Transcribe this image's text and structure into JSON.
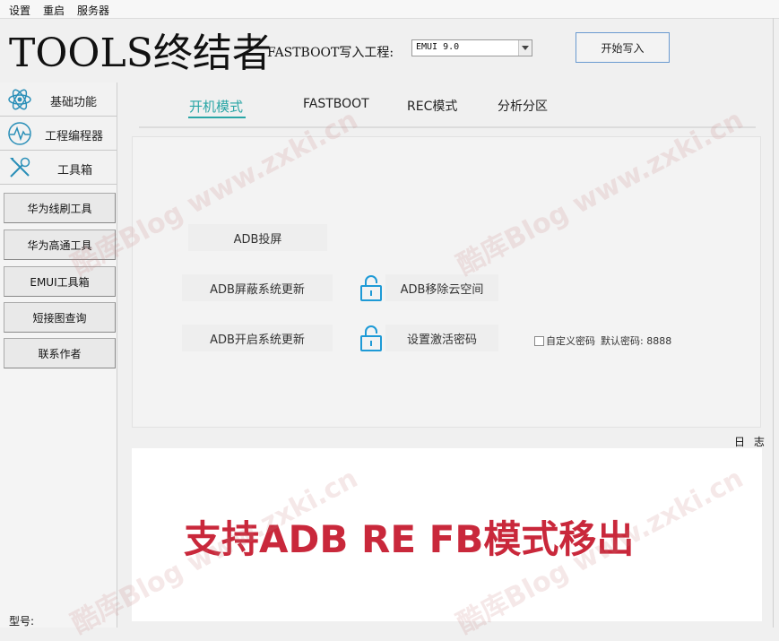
{
  "menu": {
    "items": [
      "设置",
      "重启",
      "服务器"
    ]
  },
  "header": {
    "app_title": "TOOLS终结者",
    "fastboot_label": "FASTBOOT写入工程:",
    "project_value": "EMUI 9.0",
    "start_button": "开始写入"
  },
  "sidebar": {
    "categories": [
      {
        "label": "基础功能",
        "icon": "atom-icon"
      },
      {
        "label": "工程编程器",
        "icon": "pulse-icon"
      },
      {
        "label": "工具箱",
        "icon": "tools-icon"
      }
    ],
    "buttons": [
      "华为线刷工具",
      "华为高通工具",
      "EMUI工具箱",
      "短接图查询",
      "联系作者"
    ],
    "model_label": "型号:"
  },
  "tabs": [
    "开机模式",
    "FASTBOOT",
    "REC模式",
    "分析分区"
  ],
  "active_tab": 0,
  "actions": {
    "adb_cast": "ADB投屏",
    "adb_block_update": "ADB屏蔽系统更新",
    "adb_remove_cloud": "ADB移除云空间",
    "adb_enable_update": "ADB开启系统更新",
    "set_activation_pwd": "设置激活密码"
  },
  "custom_password": {
    "label": "自定义密码",
    "default_text": "默认密码: 8888",
    "checked": false
  },
  "log": {
    "label": "日 志"
  },
  "banner": {
    "text": "支持ADB RE FB模式移出"
  },
  "watermark": {
    "text": "酷库Blog  www.zxki.cn"
  },
  "colors": {
    "accent": "#2aa6a6",
    "banner": "#c9283b"
  }
}
